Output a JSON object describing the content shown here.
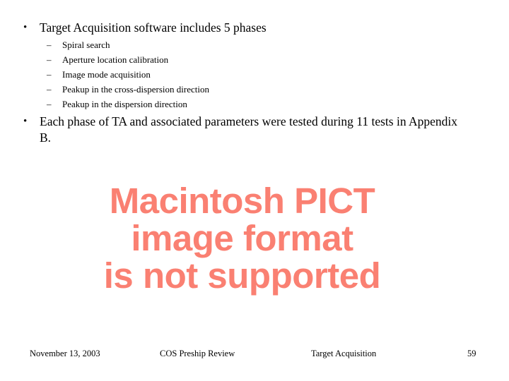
{
  "slide": {
    "background_color": "#ffffff",
    "text_color": "#000000",
    "placeholder_color": "#fa8072",
    "bullets": [
      {
        "marker": "•",
        "text": "Target Acquisition software includes 5 phases"
      },
      {
        "marker": "•",
        "text": "Each phase of TA and associated parameters were tested during 11 tests in Appendix B."
      }
    ],
    "sub_bullets": [
      {
        "marker": "–",
        "text": "Spiral search"
      },
      {
        "marker": "–",
        "text": "Aperture location calibration"
      },
      {
        "marker": "–",
        "text": "Image mode acquisition"
      },
      {
        "marker": "–",
        "text": "Peakup in the cross-dispersion direction"
      },
      {
        "marker": "–",
        "text": "Peakup in the dispersion direction"
      }
    ],
    "image_placeholder": {
      "message": "Macintosh PICT\nimage format\nis not supported",
      "line_1": "Macintosh PICT",
      "line_2": "image format",
      "line_3": "is not supported"
    },
    "footer": {
      "date": "November 13, 2003",
      "event": "COS Preship Review",
      "section": "Target Acquisition",
      "page_number": "59"
    }
  }
}
